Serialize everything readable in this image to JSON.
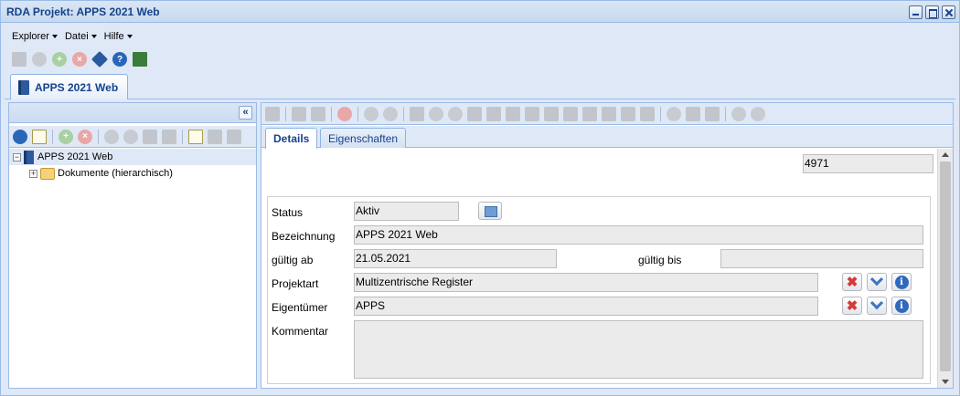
{
  "window": {
    "title": "RDA Projekt: APPS 2021 Web"
  },
  "menu": {
    "explorer": "Explorer",
    "datei": "Datei",
    "hilfe": "Hilfe"
  },
  "top_tab": {
    "label": "APPS 2021 Web"
  },
  "tree": {
    "root_label": "APPS 2021 Web",
    "child_label": "Dokumente (hierarchisch)",
    "expander_minus": "−",
    "expander_plus": "+"
  },
  "detail_tabs": {
    "details": "Details",
    "eigenschaften": "Eigenschaften"
  },
  "form": {
    "id_value": "4971",
    "status_label": "Status",
    "status_value": "Aktiv",
    "bezeichnung_label": "Bezeichnung",
    "bezeichnung_value": "APPS 2021 Web",
    "gueltig_ab_label": "gültig ab",
    "gueltig_ab_value": "21.05.2021",
    "gueltig_bis_label": "gültig bis",
    "gueltig_bis_value": "",
    "projektart_label": "Projektart",
    "projektart_value": "Multizentrische Register",
    "eigentuemer_label": "Eigentümer",
    "eigentuemer_value": "APPS",
    "kommentar_label": "Kommentar",
    "kommentar_value": ""
  },
  "colors": {
    "accent": "#15428b",
    "panel_bg": "#dfe8f6",
    "border": "#99bbe8",
    "field_bg": "#ebebeb"
  }
}
